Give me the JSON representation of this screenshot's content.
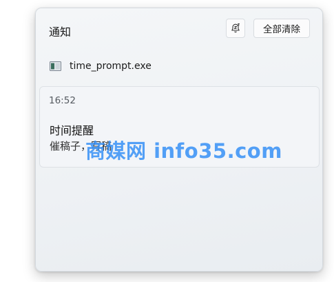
{
  "panel": {
    "title": "通知",
    "snooze_icon": "bell-snooze-icon",
    "clear_all_label": "全部清除"
  },
  "app": {
    "icon": "terminal-app-icon",
    "name": "time_prompt.exe"
  },
  "notification": {
    "time": "16:52",
    "title": "时间提醒",
    "body": "催稿子，写稿"
  },
  "watermark": {
    "text": "商媒网 info35.com"
  }
}
